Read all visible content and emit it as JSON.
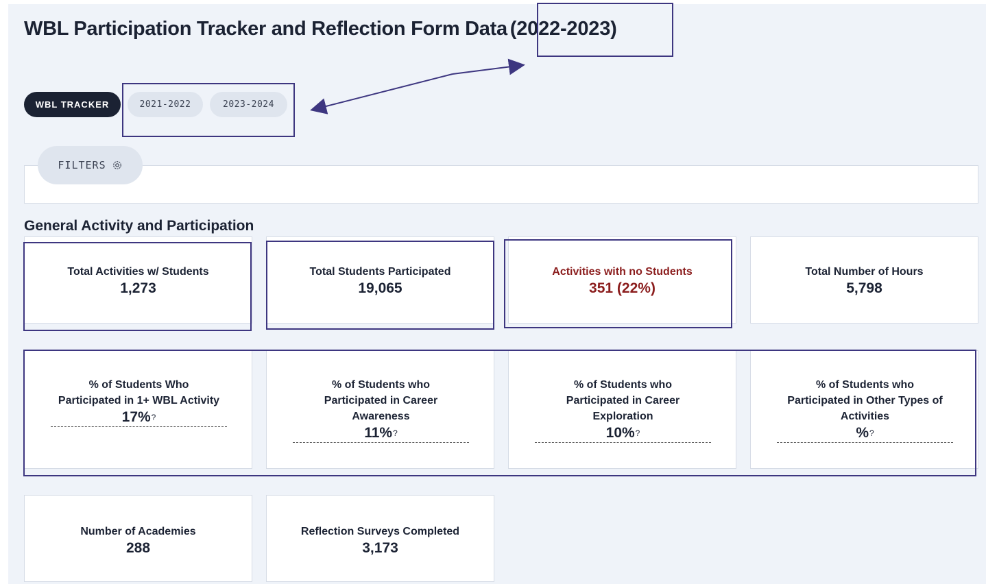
{
  "header": {
    "title": "WBL Participation Tracker and Reflection Form Data",
    "year": "(2022-2023)"
  },
  "tabs": [
    {
      "label": "WBL TRACKER",
      "active": true
    },
    {
      "label": "2021-2022",
      "active": false
    },
    {
      "label": "2023-2024",
      "active": false
    }
  ],
  "filters": {
    "label": "FILTERS",
    "icon": "gear-icon"
  },
  "section": {
    "title": "General Activity and Participation"
  },
  "stats": [
    {
      "label": "Total Activities w/ Students",
      "value": "1,273"
    },
    {
      "label": "Total Students Participated",
      "value": "19,065"
    },
    {
      "label": "Activities with no Students",
      "value": "351 (22%)",
      "color": "#8b1d1d"
    },
    {
      "label": "Total Number of Hours",
      "value": "5,798"
    }
  ],
  "percentages": [
    {
      "line1": "% of Students Who",
      "line2": "Participated in 1+ WBL Activity",
      "line3": "",
      "value": "17%",
      "hint": "?"
    },
    {
      "line1": "% of Students who",
      "line2": "Participated in Career",
      "line3": "Awareness",
      "value": "11%",
      "hint": "?"
    },
    {
      "line1": "% of Students who",
      "line2": "Participated in Career",
      "line3": "Exploration",
      "value": "10%",
      "hint": "?"
    },
    {
      "line1": "% of Students who",
      "line2": "Participated in Other Types of",
      "line3": "Activities",
      "value": "%",
      "hint": "?"
    }
  ],
  "bottom": [
    {
      "label": "Number of Academies",
      "value": "288"
    },
    {
      "label": "Reflection Surveys Completed",
      "value": "3,173"
    }
  ],
  "colors": {
    "dark": "#1b2233",
    "background": "#eff3f9",
    "annotation": "#3d3680",
    "alert": "#8b1d1d"
  }
}
